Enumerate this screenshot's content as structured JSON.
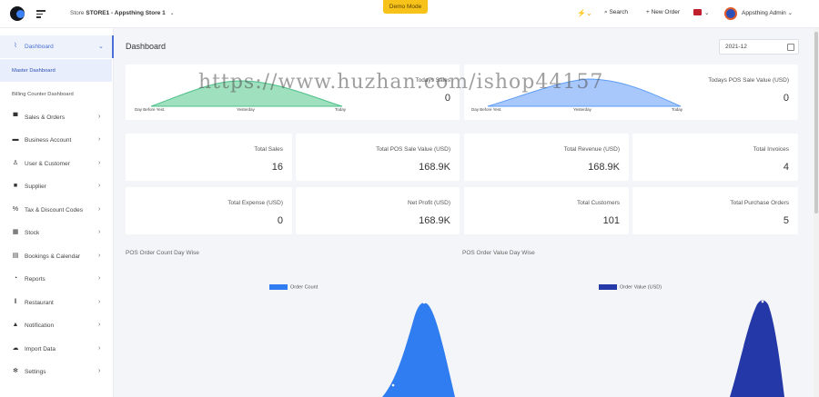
{
  "header": {
    "store_prefix": "Store",
    "store_name": "STORE1 - Appsthing Store 1",
    "demo_label": "Demo Mode",
    "search_label": "Search",
    "new_order_label": "+ New Order",
    "admin_name": "Appsthing Admin"
  },
  "sidebar": {
    "items": [
      {
        "label": "Dashboard",
        "icon": "chart-line-icon"
      },
      {
        "label": "Sales & Orders",
        "icon": "cart-icon"
      },
      {
        "label": "Business Account",
        "icon": "card-icon"
      },
      {
        "label": "User & Customer",
        "icon": "user-icon"
      },
      {
        "label": "Supplier",
        "icon": "truck-icon"
      },
      {
        "label": "Tax & Discount Codes",
        "icon": "percent-icon"
      },
      {
        "label": "Stock",
        "icon": "cubes-icon"
      },
      {
        "label": "Bookings & Calendar",
        "icon": "calendar-icon"
      },
      {
        "label": "Reports",
        "icon": "pie-chart-icon"
      },
      {
        "label": "Restaurant",
        "icon": "utensils-icon"
      },
      {
        "label": "Notification",
        "icon": "bell-icon"
      },
      {
        "label": "Import Data",
        "icon": "cloud-upload-icon"
      },
      {
        "label": "Settings",
        "icon": "gear-icon"
      }
    ],
    "sub_items": [
      {
        "label": "Master Dashboard"
      },
      {
        "label": "Billing Counter Dashboard"
      }
    ]
  },
  "main": {
    "title": "Dashboard",
    "date_value": "2021-12",
    "mini_cards": [
      {
        "title": "Todays Sales",
        "value": "0",
        "labels": [
          "Day Before Yest.",
          "Yesterday",
          "Today"
        ],
        "color": "#6fcf97"
      },
      {
        "title": "Todays POS Sale Value (USD)",
        "value": "0",
        "labels": [
          "Day Before Yest.",
          "Yesterday",
          "Today"
        ],
        "color": "#5b9cf5"
      }
    ],
    "stats": [
      {
        "title": "Total Sales",
        "value": "16"
      },
      {
        "title": "Total POS Sale Value (USD)",
        "value": "168.9K"
      },
      {
        "title": "Total Revenue (USD)",
        "value": "168.9K"
      },
      {
        "title": "Total Invoices",
        "value": "4"
      },
      {
        "title": "Total Expense (USD)",
        "value": "0"
      },
      {
        "title": "Net Profit (USD)",
        "value": "168.9K"
      },
      {
        "title": "Total Customers",
        "value": "101"
      },
      {
        "title": "Total Purchase Orders",
        "value": "5"
      }
    ],
    "charts": [
      {
        "title": "POS Order Count Day Wise",
        "legend": "Order Count",
        "color": "#2f7df0"
      },
      {
        "title": "POS Order Value Day Wise",
        "legend": "Order Value (USD)",
        "color": "#2438a8"
      }
    ]
  },
  "watermark": "https://www.huzhan.com/ishop44157"
}
